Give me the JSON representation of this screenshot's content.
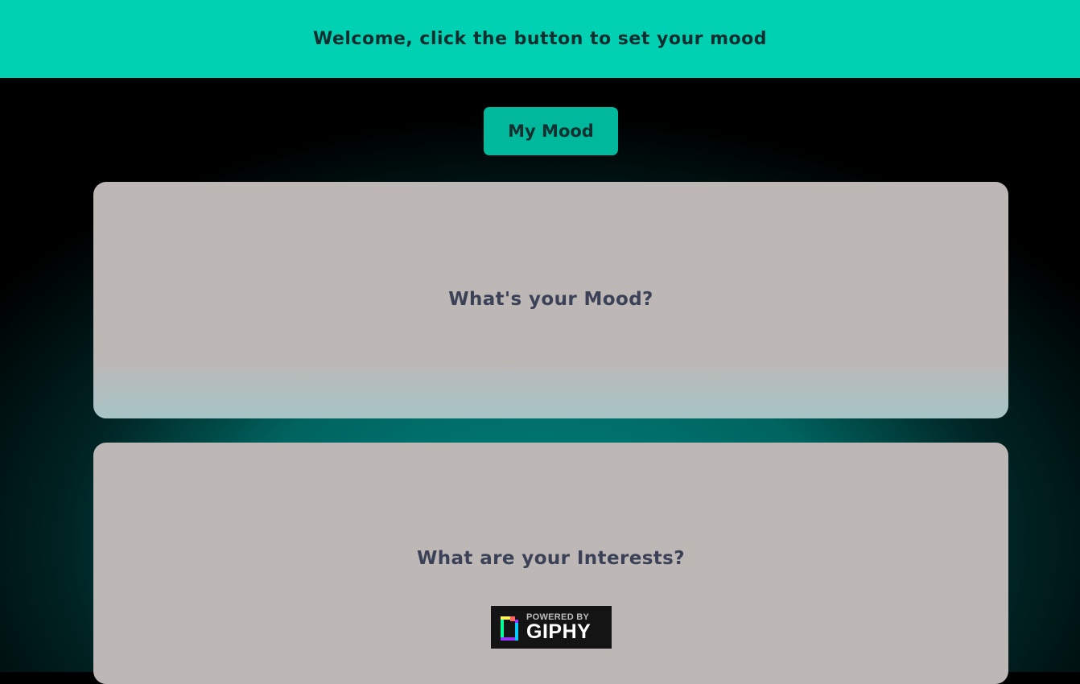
{
  "header": {
    "title": "Welcome, click the button to set your mood",
    "background_color": "#00d1b2"
  },
  "mood_button": {
    "label": "My Mood",
    "color": "#00b89c"
  },
  "mood_card": {
    "title": "What's your Mood?"
  },
  "interests_card": {
    "title": "What are your Interests?"
  },
  "giphy_badge": {
    "powered_label": "POWERED BY",
    "brand_label": "GIPHY",
    "icon": "giphy-logo-icon"
  },
  "colors": {
    "page_background": "#000000",
    "glow": "#008c87",
    "card_background": "#bdb7b6",
    "card_title": "#3b4257"
  }
}
